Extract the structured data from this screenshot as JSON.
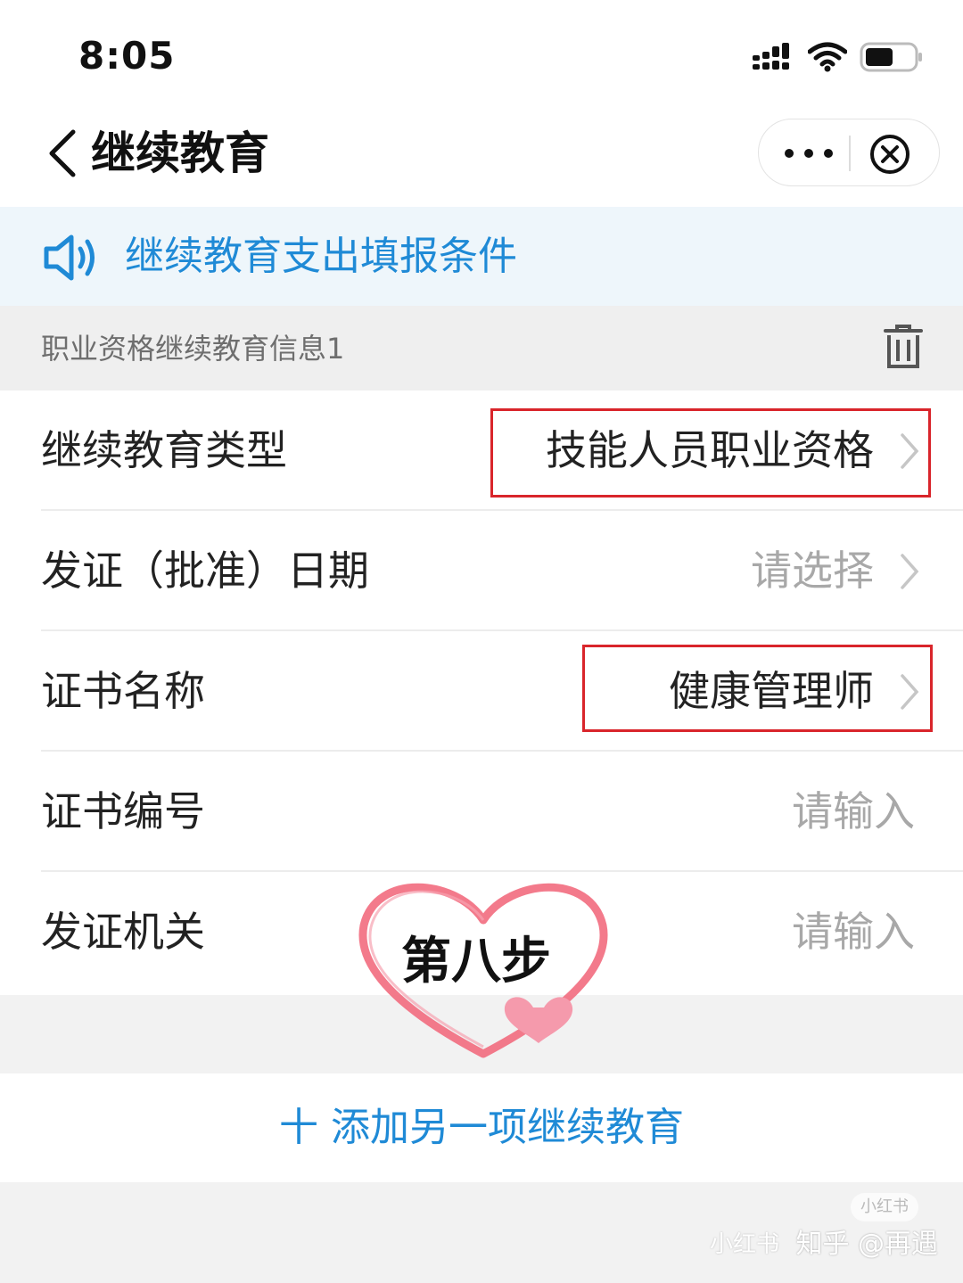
{
  "status_bar": {
    "time": "8:05",
    "icons": [
      "signal-icon",
      "wifi-icon",
      "battery-icon"
    ]
  },
  "nav": {
    "title": "继续教育",
    "icons": [
      "back-icon",
      "more-icon",
      "close-icon"
    ]
  },
  "notice": {
    "text": "继续教育支出填报条件",
    "icon": "speaker-icon"
  },
  "section": {
    "title": "职业资格继续教育信息1",
    "icon": "trash-icon"
  },
  "form": {
    "rows": [
      {
        "label": "继续教育类型",
        "value": "技能人员职业资格"
      },
      {
        "label": "发证（批准）日期",
        "value": "请选择"
      },
      {
        "label": "证书名称",
        "value": "健康管理师"
      },
      {
        "label": "证书编号",
        "value": "请输入"
      },
      {
        "label": "发证机关",
        "value": "请输入"
      }
    ]
  },
  "add_button": {
    "label": "十 添加另一项继续教育"
  },
  "overlay": {
    "sticker_text": "第八步"
  },
  "watermark": {
    "badge": "小红书",
    "left": "小红书",
    "text": "知乎 @再遇"
  },
  "colors": {
    "accent": "#1f8ad6",
    "highlight_border": "#d9252b",
    "placeholder": "#a8a8a8",
    "heart": "#f26b7e"
  }
}
